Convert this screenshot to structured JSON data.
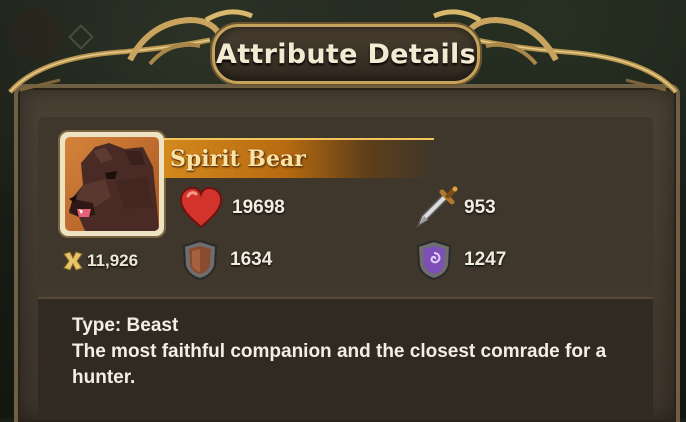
{
  "window": {
    "title": "Attribute Details"
  },
  "unit": {
    "name": "Spirit Bear",
    "portrait_icon": "bear-portrait",
    "power": "11,926",
    "stats": {
      "hp": {
        "icon": "heart-icon",
        "value": "19698"
      },
      "attack": {
        "icon": "sword-icon",
        "value": "953"
      },
      "defense": {
        "icon": "shield-icon",
        "value": "1634"
      },
      "magic_defense": {
        "icon": "magic-shield-icon",
        "value": "1247"
      }
    }
  },
  "description": {
    "type_line": "Type: Beast",
    "text": "The most faithful companion and the closest comrade for a hunter."
  },
  "colors": {
    "accent_gold": "#c6a35c",
    "banner_orange": "#d4891d",
    "heart_red": "#d2342c",
    "magic_purple": "#7e4fb8"
  }
}
